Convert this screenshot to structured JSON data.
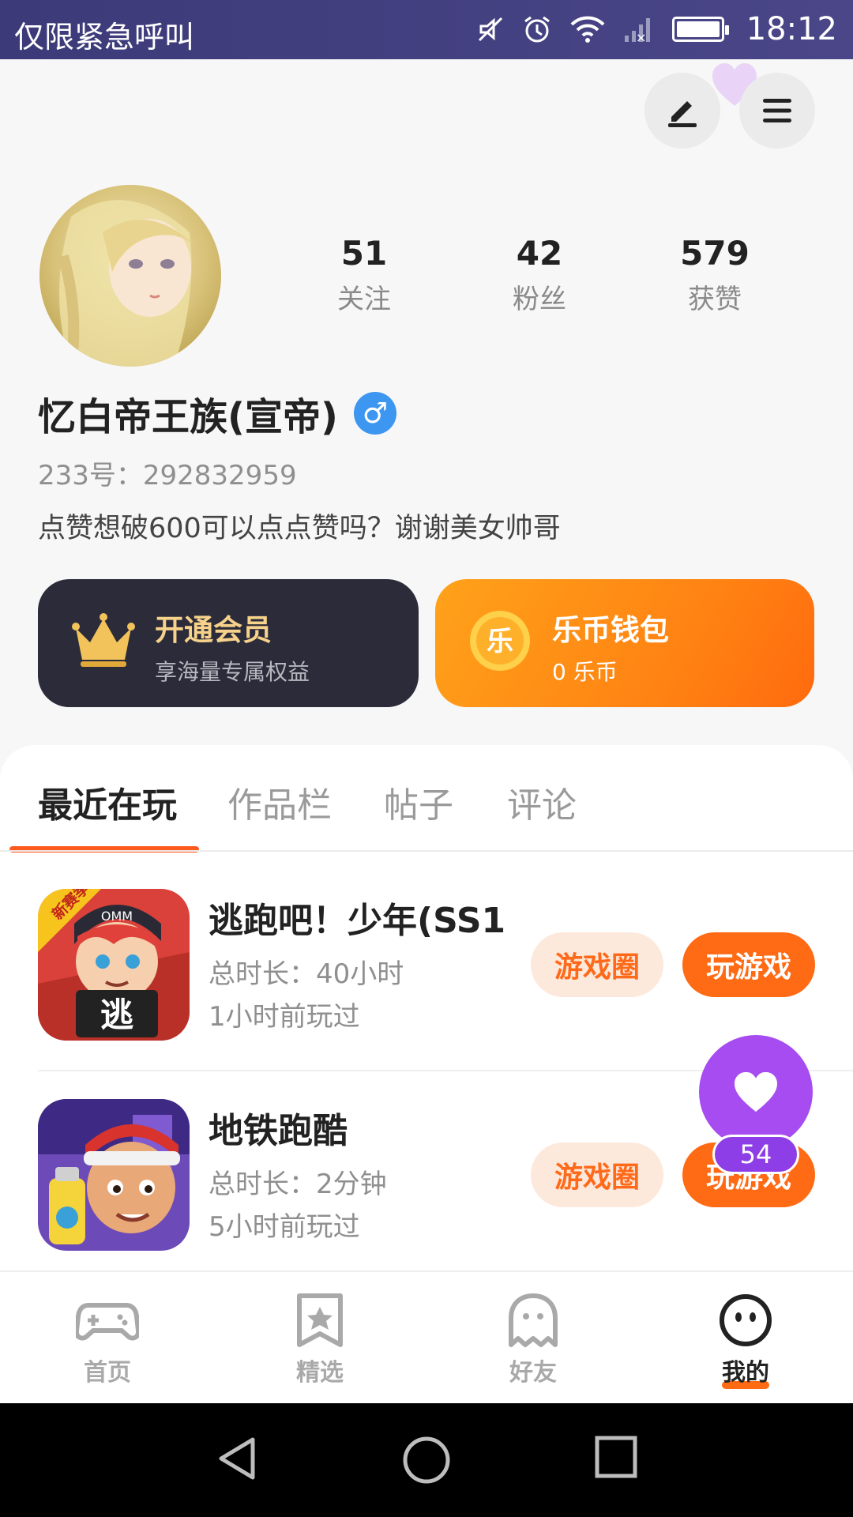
{
  "status_bar": {
    "carrier": "仅限紧急呼叫",
    "time": "18:12"
  },
  "profile": {
    "stats": [
      {
        "value": "51",
        "label": "关注"
      },
      {
        "value": "42",
        "label": "粉丝"
      },
      {
        "value": "579",
        "label": "获赞"
      }
    ],
    "name": "忆白帝王族(宣帝)",
    "gender_symbol": "♂",
    "uid": "233号：292832959",
    "bio": "点赞想破600可以点点赞吗？谢谢美女帅哥"
  },
  "cards": {
    "vip": {
      "title": "开通会员",
      "subtitle": "享海量专属权益"
    },
    "wallet": {
      "title": "乐币钱包",
      "subtitle": "0 乐币",
      "coin_char": "乐"
    }
  },
  "tabs": [
    {
      "label": "最近在玩",
      "active": true
    },
    {
      "label": "作品栏",
      "active": false
    },
    {
      "label": "帖子",
      "active": false
    },
    {
      "label": "评论",
      "active": false
    }
  ],
  "games": [
    {
      "title": "逃跑吧！少年(SS1...",
      "duration": "总时长：40小时",
      "last_played": "1小时前玩过",
      "circle_label": "游戏圈",
      "play_label": "玩游戏",
      "icon_badge": "新赛季",
      "icon_char": "逃",
      "icon_brand": "OMM"
    },
    {
      "title": "地铁跑酷",
      "duration": "总时长：2分钟",
      "last_played": "5小时前玩过",
      "circle_label": "游戏圈",
      "play_label": "玩游戏"
    }
  ],
  "fab": {
    "count": "54"
  },
  "bottom_nav": [
    {
      "label": "首页",
      "icon": "gamepad-icon"
    },
    {
      "label": "精选",
      "icon": "star-bookmark-icon"
    },
    {
      "label": "好友",
      "icon": "ghost-icon"
    },
    {
      "label": "我的",
      "icon": "smiley-face-icon",
      "active": true
    }
  ],
  "colors": {
    "accent": "#ff6a14",
    "vip_card": "#2b2b3a",
    "fab": "#a64cf0",
    "gender": "#3d96f0"
  }
}
